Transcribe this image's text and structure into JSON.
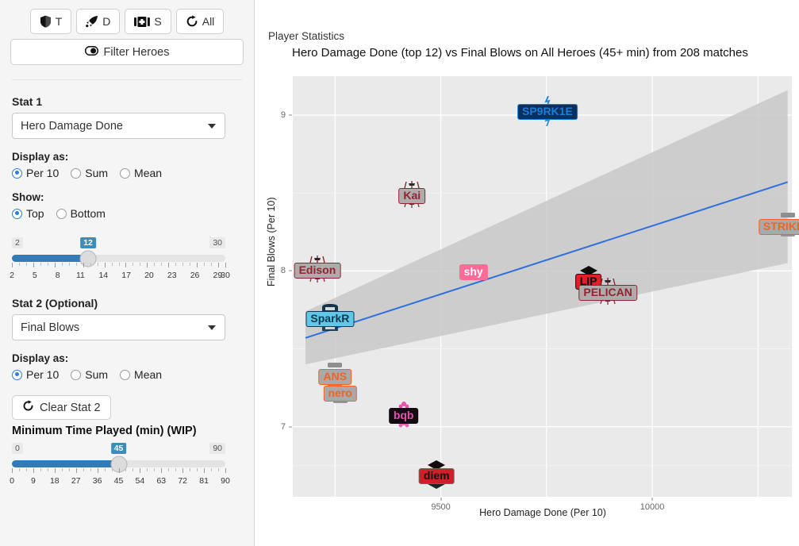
{
  "sidebar": {
    "role_buttons": [
      {
        "label": "T",
        "icon": "shield-icon",
        "name": "role-tank-button"
      },
      {
        "label": "D",
        "icon": "rocket-icon",
        "name": "role-damage-button"
      },
      {
        "label": "S",
        "icon": "medkit-icon",
        "name": "role-support-button"
      },
      {
        "label": "All",
        "icon": "refresh-icon",
        "name": "role-all-button"
      }
    ],
    "filter_heroes": {
      "label": "Filter Heroes",
      "icon": "toggle-icon"
    },
    "stat1": {
      "label": "Stat 1",
      "value": "Hero Damage Done",
      "display_label": "Display as:",
      "options": [
        "Per 10",
        "Sum",
        "Mean"
      ],
      "selected": "Per 10",
      "show_label": "Show:",
      "show_options": [
        "Top",
        "Bottom"
      ],
      "show_selected": "Top"
    },
    "count_slider": {
      "min": "2",
      "max": "30",
      "value": "12",
      "ticks": [
        "2",
        "5",
        "8",
        "11",
        "14",
        "17",
        "20",
        "23",
        "26",
        "29",
        "30"
      ]
    },
    "stat2": {
      "label": "Stat 2 (Optional)",
      "value": "Final Blows",
      "display_label": "Display as:",
      "options": [
        "Per 10",
        "Sum",
        "Mean"
      ],
      "selected": "Per 10",
      "clear_label": "Clear Stat 2",
      "clear_icon": "refresh-icon"
    },
    "time_slider": {
      "title": "Minimum Time Played (min) (WIP)",
      "min": "0",
      "max": "90",
      "value": "45",
      "ticks": [
        "0",
        "9",
        "18",
        "27",
        "36",
        "45",
        "54",
        "63",
        "72",
        "81",
        "90"
      ]
    }
  },
  "chart": {
    "panel_title": "Player Statistics",
    "title": "Hero Damage Done (top 12) vs Final Blows on All Heroes (45+ min) from 208 matches"
  },
  "chart_data": {
    "type": "scatter",
    "title": "Hero Damage Done (top 12) vs Final Blows on All Heroes (45+ min) from 208 matches",
    "xlabel": "Hero Damage Done (Per 10)",
    "ylabel": "Final Blows (Per 10)",
    "xlim": [
      9150,
      10330
    ],
    "ylim": [
      6.55,
      9.25
    ],
    "xticks": [
      "9500",
      "10000"
    ],
    "xtick_values": [
      9500,
      10000
    ],
    "yticks": [
      "7",
      "8",
      "9"
    ],
    "ytick_values": [
      7,
      8,
      9
    ],
    "grid": true,
    "legend": "none",
    "trendline": {
      "color": "#2f6fe0",
      "x": [
        9180,
        10320
      ],
      "y": [
        7.57,
        8.57
      ]
    },
    "confidence_band": {
      "color": "#c8c8c8",
      "x": [
        9180,
        10320
      ],
      "upper": [
        7.74,
        9.16
      ],
      "lower": [
        7.4,
        8.05
      ]
    },
    "points": [
      {
        "name": "SP9RK1E",
        "x": 9752,
        "y": 9.02,
        "bg": "#0b2f5e",
        "fg": "#1a7fd4",
        "border": "#1a7fd4",
        "crest": "dark-blue-bolt"
      },
      {
        "name": "STRIKER",
        "x": 10320,
        "y": 8.28,
        "bg": "#a9a9a9",
        "fg": "#f4621f",
        "border": "#f4621f",
        "crest": "gray-orange"
      },
      {
        "name": "Kai",
        "x": 9432,
        "y": 8.48,
        "bg": "#b0abab",
        "fg": "#8f2432",
        "border": "#8f2432",
        "crest": "red-crown"
      },
      {
        "name": "Edison",
        "x": 9208,
        "y": 8.0,
        "bg": "#b0abab",
        "fg": "#8f2432",
        "border": "#8f2432",
        "crest": "red-crown"
      },
      {
        "name": "shy",
        "x": 9577,
        "y": 7.99,
        "bg": "#ff6b96",
        "fg": "#ffffff",
        "border": "#ff6b96",
        "crest": "none"
      },
      {
        "name": "LIP",
        "x": 9849,
        "y": 7.93,
        "bg": "#e01f26",
        "fg": "#111111",
        "border": "#111111",
        "crest": "black-diamond"
      },
      {
        "name": "PELICAN",
        "x": 9895,
        "y": 7.86,
        "bg": "#b0abab",
        "fg": "#8f2432",
        "border": "#8f2432",
        "crest": "red-crown"
      },
      {
        "name": "SparkR",
        "x": 9238,
        "y": 7.69,
        "bg": "#5fc7e8",
        "fg": "#12364f",
        "border": "#12364f",
        "crest": "navy-shield"
      },
      {
        "name": "ANS",
        "x": 9250,
        "y": 7.32,
        "bg": "#a9a9a9",
        "fg": "#f4621f",
        "border": "#f4621f",
        "crest": "gray-orange"
      },
      {
        "name": "nero",
        "x": 9262,
        "y": 7.21,
        "bg": "#a9a9a9",
        "fg": "#f4621f",
        "border": "#f4621f",
        "crest": "gray-orange"
      },
      {
        "name": "bqb",
        "x": 9412,
        "y": 7.07,
        "bg": "#150b12",
        "fg": "#e84fb0",
        "border": "#150b12",
        "crest": "pink-flower"
      },
      {
        "name": "diem",
        "x": 9490,
        "y": 6.68,
        "bg": "#cf2027",
        "fg": "#111111",
        "border": "#666666",
        "crest": "black-diamond"
      }
    ]
  }
}
